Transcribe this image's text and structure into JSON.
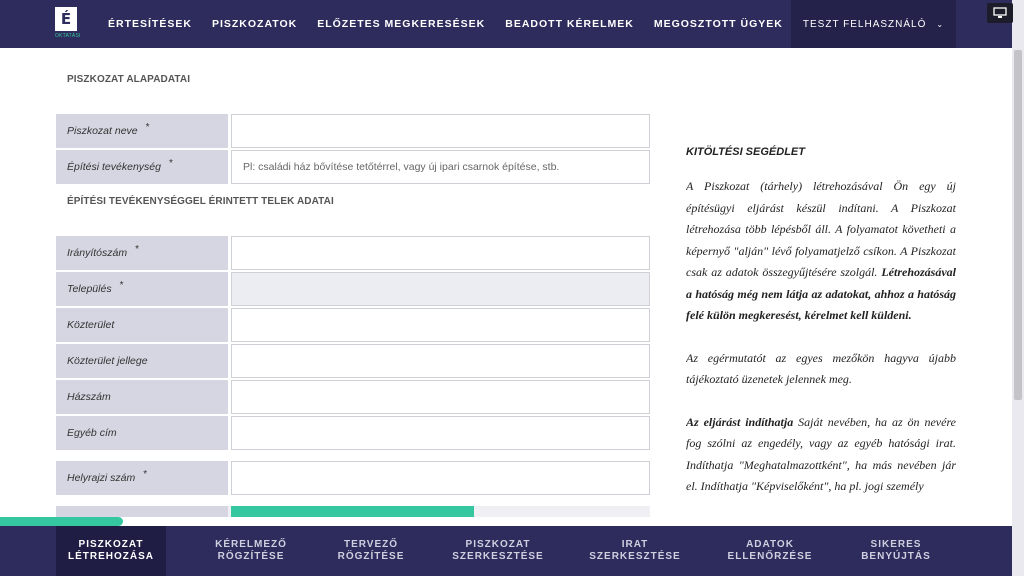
{
  "header": {
    "logo_letter": "É",
    "logo_sub": "OKTATÁSI",
    "nav": [
      "ÉRTESÍTÉSEK",
      "PISZKOZATOK",
      "ELŐZETES MEGKERESÉSEK",
      "BEADOTT KÉRELMEK",
      "MEGOSZTOTT ÜGYEK"
    ],
    "user": "TESZT FELHASZNÁLÓ"
  },
  "form": {
    "section_basic": "PISZKOZAT ALAPADATAI",
    "section_land": "ÉPÍTÉSI TEVÉKENYSÉGGEL ÉRINTETT TELEK ADATAI",
    "required_mark": "*",
    "fields": {
      "name": {
        "label": "Piszkozat neve",
        "value": "",
        "placeholder": ""
      },
      "activity": {
        "label": "Építési tevékenység",
        "value": "",
        "placeholder": "Pl: családi ház bővítése tetőtérrel, vagy új ipari csarnok építése, stb."
      },
      "zip": {
        "label": "Irányítószám",
        "value": ""
      },
      "city": {
        "label": "Település",
        "value": ""
      },
      "street": {
        "label": "Közterület",
        "value": ""
      },
      "street_type": {
        "label": "Közterület jellege",
        "value": ""
      },
      "house": {
        "label": "Házszám",
        "value": ""
      },
      "other": {
        "label": "Egyéb cím",
        "value": ""
      },
      "parcel": {
        "label": "Helyrajzi szám",
        "value": ""
      }
    }
  },
  "help": {
    "title": "KITÖLTÉSI SEGÉDLET",
    "p1_a": "A Piszkozat (tárhely) létrehozásával Ön egy új építésügyi eljárást készül indítani. A Piszkozat létrehozása több lépésből áll. A folyamatot követheti a képernyő \"alján\" lévő folyamatjelző csíkon. A Piszkozat csak az adatok összegyűjtésére szolgál. ",
    "p1_b": "Létrehozásával a hatóság még nem látja az adatokat, ahhoz a hatóság felé külön megkeresést, kérelmet kell küldeni.",
    "p2": "Az egérmutatót az egyes mezőkön hagyva újabb tájékoztató üzenetek jelennek meg.",
    "p3_a": "Az eljárást indíthatja",
    "p3_b": " Saját nevében, ha az ön nevére fog szólni az engedély, vagy az egyéb hatósági irat. Indíthatja \"Meghatalmazottként\", ha más nevében jár el. Indíthatja \"Képviselőként\", ha pl. jogi személy"
  },
  "progress": {
    "fraction": 0.58
  },
  "steps": [
    {
      "l1": "PISZKOZAT",
      "l2": "LÉTREHOZÁSA",
      "active": true
    },
    {
      "l1": "KÉRELMEZŐ",
      "l2": "RÖGZÍTÉSE",
      "active": false
    },
    {
      "l1": "TERVEZŐ",
      "l2": "RÖGZÍTÉSE",
      "active": false
    },
    {
      "l1": "PISZKOZAT",
      "l2": "SZERKESZTÉSE",
      "active": false
    },
    {
      "l1": "IRAT",
      "l2": "SZERKESZTÉSE",
      "active": false
    },
    {
      "l1": "ADATOK",
      "l2": "ELLENŐRZÉSE",
      "active": false
    },
    {
      "l1": "SIKERES",
      "l2": "BENYÚJTÁS",
      "active": false
    }
  ]
}
